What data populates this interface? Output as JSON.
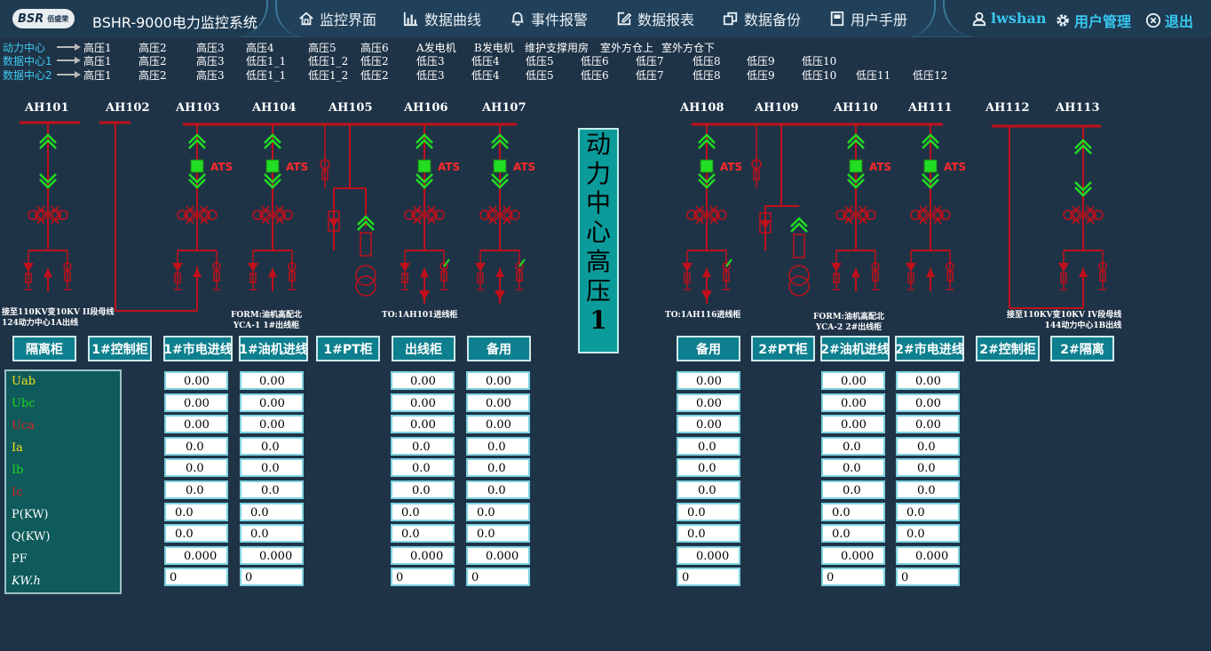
{
  "header": {
    "logo_text": "BSR",
    "logo_sub": "佰盛荣",
    "title": "BSHR-9000电力监控系统"
  },
  "nav": {
    "items": [
      {
        "label": "监控界面"
      },
      {
        "label": "数据曲线"
      },
      {
        "label": "事件报警"
      },
      {
        "label": "数据报表"
      },
      {
        "label": "数据备份"
      },
      {
        "label": "用户手册"
      }
    ]
  },
  "user": {
    "name": "lwshan",
    "manage": "用户管理",
    "logout": "退出"
  },
  "subnav": [
    {
      "label": "动力中心",
      "items": [
        "高压1",
        "高压2",
        "高压3",
        "高压4",
        "高压5",
        "高压6",
        "A发电机",
        "B发电机",
        "维护支撑用房",
        "室外方仓上",
        "室外方仓下"
      ]
    },
    {
      "label": "数据中心1",
      "items": [
        "高压1",
        "高压2",
        "高压3",
        "低压1_1",
        "低压1_2",
        "低压2",
        "低压3",
        "低压4",
        "低压5",
        "低压6",
        "低压7",
        "低压8",
        "低压9",
        "低压10"
      ]
    },
    {
      "label": "数据中心2",
      "items": [
        "高压1",
        "高压2",
        "高压3",
        "低压1_1",
        "低压1_2",
        "低压2",
        "低压3",
        "低压4",
        "低压5",
        "低压6",
        "低压7",
        "低压8",
        "低压9",
        "低压10",
        "低压11",
        "低压12"
      ]
    }
  ],
  "cabinets": [
    "AH101",
    "AH102",
    "AH103",
    "AH104",
    "AH105",
    "AH106",
    "AH107",
    "AH108",
    "AH109",
    "AH110",
    "AH111",
    "AH112",
    "AH113"
  ],
  "ats_label": "ATS",
  "notes": {
    "n1a": "接至110KV变10KV II段母线",
    "n1b": "124动力中心1A出线",
    "n2a": "FORM:油机高配北",
    "n2b": "YCA-1  1#出线柜",
    "n3": "TO:1AH101进线柜",
    "n4": "TO:1AH116进线柜",
    "n5a": "FORM:油机高配北",
    "n5b": "YCA-2  2#出线柜",
    "n6a": "接至110KV变10KV IV段母线",
    "n6b": "144动力中心1B出线"
  },
  "center_title": [
    "动",
    "力",
    "中",
    "心",
    "高",
    "压",
    "1"
  ],
  "buttons": [
    "隔离柜",
    "1#控制柜",
    "1#市电进线",
    "1#油机进线",
    "1#PT柜",
    "出线柜",
    "备用",
    "备用",
    "2#PT柜",
    "2#油机进线",
    "2#市电进线",
    "2#控制柜",
    "2#隔离"
  ],
  "measurements": {
    "labels": [
      {
        "text": "Uab",
        "color": "#f2e418"
      },
      {
        "text": "Ubc",
        "color": "#22d622"
      },
      {
        "text": "Uca",
        "color": "#e02020"
      },
      {
        "text": "Ia",
        "color": "#f2e418"
      },
      {
        "text": "Ib",
        "color": "#22d622"
      },
      {
        "text": "Ic",
        "color": "#e02020"
      },
      {
        "text": "P(KW)",
        "color": "#ffffff"
      },
      {
        "text": "Q(KW)",
        "color": "#ffffff"
      },
      {
        "text": "PF",
        "color": "#ffffff"
      },
      {
        "text": "KW.h",
        "color": "#ffffff"
      }
    ],
    "columns": [
      {
        "cabinet": "1#市电进线",
        "values": [
          "0.00",
          "0.00",
          "0.00",
          "0.0",
          "0.0",
          "0.0",
          "0.0",
          "0.0",
          "0.000",
          "0"
        ]
      },
      {
        "cabinet": "1#油机进线",
        "values": [
          "0.00",
          "0.00",
          "0.00",
          "0.0",
          "0.0",
          "0.0",
          "0.0",
          "0.0",
          "0.000",
          "0"
        ]
      },
      {
        "cabinet": "出线柜",
        "values": [
          "0.00",
          "0.00",
          "0.00",
          "0.0",
          "0.0",
          "0.0",
          "0.0",
          "0.0",
          "0.000",
          "0"
        ]
      },
      {
        "cabinet": "备用",
        "values": [
          "0.00",
          "0.00",
          "0.00",
          "0.0",
          "0.0",
          "0.0",
          "0.0",
          "0.0",
          "0.000",
          "0"
        ]
      },
      {
        "cabinet": "备用",
        "values": [
          "0.00",
          "0.00",
          "0.00",
          "0.0",
          "0.0",
          "0.0",
          "0.0",
          "0.0",
          "0.000",
          "0"
        ]
      },
      {
        "cabinet": "2#油机进线",
        "values": [
          "0.00",
          "0.00",
          "0.00",
          "0.0",
          "0.0",
          "0.0",
          "0.0",
          "0.0",
          "0.000",
          "0"
        ]
      },
      {
        "cabinet": "2#市电进线",
        "values": [
          "0.00",
          "0.00",
          "0.00",
          "0.0",
          "0.0",
          "0.0",
          "0.0",
          "0.0",
          "0.000",
          "0"
        ]
      }
    ]
  },
  "colors": {
    "background": "#1f3347",
    "accent": "#38c6ef",
    "bus": "#c0101a",
    "status_green": "#22dd22",
    "button_teal": "#0d7f8e"
  }
}
